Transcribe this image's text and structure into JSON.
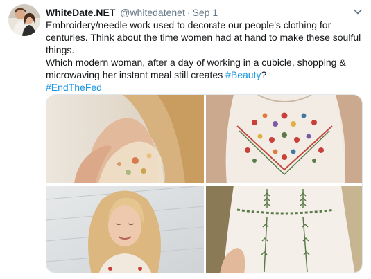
{
  "tweet": {
    "display_name": "WhiteDate.NET",
    "handle": "@whitedatenet",
    "separator": "·",
    "date": "Sep 1",
    "lines": [
      "Embroidery/needle work used to decorate our people's clothing for",
      "centuries. Think about the time women had at hand to make these soulful",
      "things."
    ],
    "line4_text": "Which modern woman, after a day of working in a cubicle, shopping &",
    "line5_text": "microwaving her instant meal still creates ",
    "hashtag_beauty": "#Beauty",
    "line5_end": "?",
    "hashtag_endthefed": "#EndTheFed"
  },
  "icons": {
    "avatar": "profile-photo-couple",
    "caret": "chevron-down-icon"
  },
  "colors": {
    "link": "#1b95e0",
    "secondary_text": "#657786",
    "primary_text": "#14171a"
  }
}
